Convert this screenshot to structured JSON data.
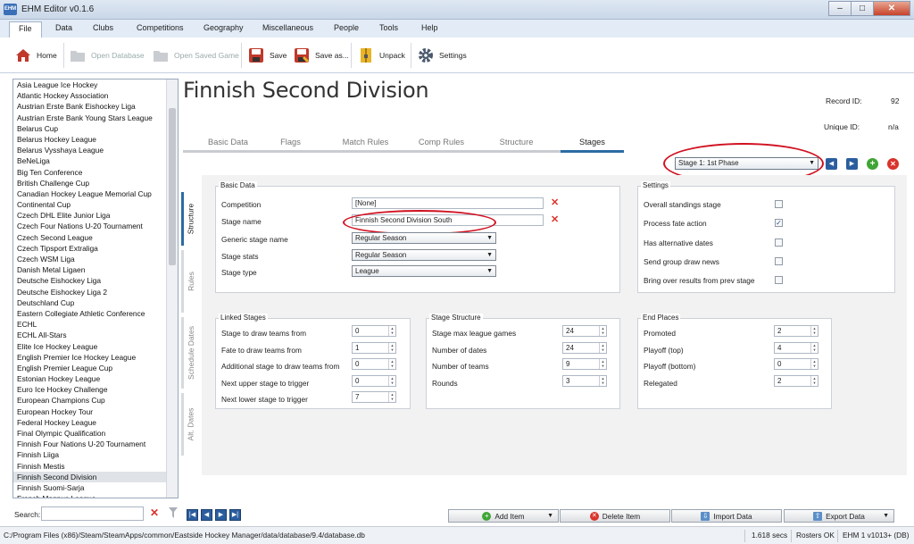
{
  "window": {
    "title": "EHM Editor v0.1.6",
    "icon_label": "EHM"
  },
  "menu": [
    "File",
    "Data",
    "Clubs",
    "Competitions",
    "Geography",
    "Miscellaneous",
    "People",
    "Tools",
    "Help"
  ],
  "toolbar": {
    "home": "Home",
    "open_database": "Open Database",
    "open_saved_game": "Open Saved Game",
    "save": "Save",
    "save_as": "Save as...",
    "unpack": "Unpack",
    "settings": "Settings"
  },
  "leagues": [
    "Asia League Ice Hockey",
    "Atlantic Hockey Association",
    "Austrian Erste Bank Eishockey Liga",
    "Austrian Erste Bank Young Stars League",
    "Belarus Cup",
    "Belarus Hockey League",
    "Belarus Vysshaya League",
    "BeNeLiga",
    "Big Ten Conference",
    "British Challenge Cup",
    "Canadian Hockey League Memorial Cup",
    "Continental Cup",
    "Czech DHL Elite Junior Liga",
    "Czech Four Nations U-20 Tournament",
    "Czech Second League",
    "Czech Tipsport Extraliga",
    "Czech WSM Liga",
    "Danish Metal Ligaen",
    "Deutsche Eishockey Liga",
    "Deutsche Eishockey Liga 2",
    "Deutschland Cup",
    "Eastern Collegiate Athletic Conference",
    "ECHL",
    "ECHL All-Stars",
    "Elite Ice Hockey League",
    "English Premier Ice Hockey League",
    "English Premier League Cup",
    "Estonian Hockey League",
    "Euro Ice Hockey Challenge",
    "European Champions Cup",
    "European Hockey Tour",
    "Federal Hockey League",
    "Final Olympic Qualification",
    "Finnish Four Nations U-20 Tournament",
    "Finnish Liiga",
    "Finnish Mestis",
    "Finnish Second Division",
    "Finnish Suomi-Sarja",
    "French Magnus League"
  ],
  "selected_league": "Finnish Second Division",
  "search": {
    "label": "Search:",
    "value": ""
  },
  "header": {
    "title": "Finnish Second Division",
    "record_id_label": "Record ID:",
    "record_id": "92",
    "unique_id_label": "Unique ID:",
    "unique_id": "n/a"
  },
  "tabs": [
    "Basic Data",
    "Flags",
    "Match Rules",
    "Comp Rules",
    "Structure",
    "Stages"
  ],
  "active_tab": "Stages",
  "stage_selector": {
    "value": "Stage 1: 1st Phase"
  },
  "side_tabs": [
    "Structure",
    "Rules",
    "Schedule Dates",
    "Alt. Dates"
  ],
  "basic_data": {
    "title": "Basic Data",
    "competition_label": "Competition",
    "competition": "[None]",
    "stage_name_label": "Stage name",
    "stage_name": "Finnish Second Division South",
    "generic_stage_name_label": "Generic stage name",
    "generic_stage_name": "Regular Season",
    "stage_stats_label": "Stage stats",
    "stage_stats": "Regular Season",
    "stage_type_label": "Stage type",
    "stage_type": "League"
  },
  "settings": {
    "title": "Settings",
    "items": [
      {
        "label": "Overall standings stage",
        "checked": false
      },
      {
        "label": "Process fate action",
        "checked": true
      },
      {
        "label": "Has alternative dates",
        "checked": false
      },
      {
        "label": "Send group draw news",
        "checked": false
      },
      {
        "label": "Bring over results from prev stage",
        "checked": false
      }
    ]
  },
  "linked_stages": {
    "title": "Linked Stages",
    "fields": [
      {
        "label": "Stage to draw teams from",
        "value": "0"
      },
      {
        "label": "Fate to draw teams from",
        "value": "1"
      },
      {
        "label": "Additional stage to draw teams from",
        "value": "0"
      },
      {
        "label": "Next upper stage to trigger",
        "value": "0"
      },
      {
        "label": "Next lower stage to trigger",
        "value": "7"
      }
    ]
  },
  "stage_structure": {
    "title": "Stage Structure",
    "fields": [
      {
        "label": "Stage max league games",
        "value": "24"
      },
      {
        "label": "Number of dates",
        "value": "24"
      },
      {
        "label": "Number of teams",
        "value": "9"
      },
      {
        "label": "Rounds",
        "value": "3"
      }
    ]
  },
  "end_places": {
    "title": "End Places",
    "fields": [
      {
        "label": "Promoted",
        "value": "2"
      },
      {
        "label": "Playoff (top)",
        "value": "4"
      },
      {
        "label": "Playoff (bottom)",
        "value": "0"
      },
      {
        "label": "Relegated",
        "value": "2"
      }
    ]
  },
  "actions": {
    "add": "Add Item",
    "delete": "Delete Item",
    "import": "Import Data",
    "export": "Export Data"
  },
  "status": {
    "path": "C:/Program Files (x86)/Steam/SteamApps/common/Eastside Hockey Manager/data/database/9.4/database.db",
    "time": "1.618 secs",
    "rosters": "Rosters OK",
    "version": "EHM 1 v1013+ (DB)"
  },
  "colors": {
    "accent": "#2b6ca3",
    "annotation": "#d01020",
    "delete": "#d9342b",
    "add": "#3fa535"
  }
}
